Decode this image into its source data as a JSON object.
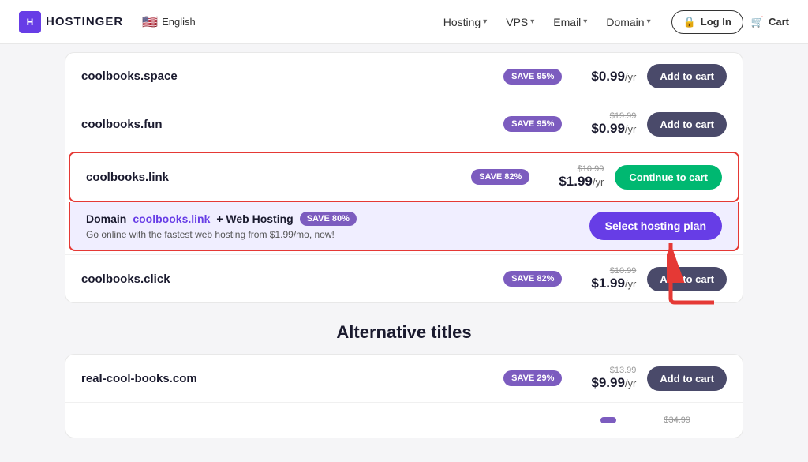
{
  "navbar": {
    "logo_text": "HOSTINGER",
    "lang": "English",
    "nav_items": [
      {
        "label": "Hosting",
        "has_dropdown": true
      },
      {
        "label": "VPS",
        "has_dropdown": true
      },
      {
        "label": "Email",
        "has_dropdown": true
      },
      {
        "label": "Domain",
        "has_dropdown": true
      }
    ],
    "login_label": "Log In",
    "cart_label": "Cart"
  },
  "main": {
    "domains": [
      {
        "name": "coolbooks.space",
        "save_pct": "SAVE 95%",
        "price_original": "",
        "price_current": "$0.99/yr",
        "btn_label": "Add to cart",
        "highlighted": false
      },
      {
        "name": "coolbooks.fun",
        "save_pct": "SAVE 95%",
        "price_original": "$19.99",
        "price_current": "$0.99/yr",
        "btn_label": "Add to cart",
        "highlighted": false
      },
      {
        "name": "coolbooks.link",
        "save_pct": "SAVE 82%",
        "price_original": "$10.99",
        "price_current": "$1.99/yr",
        "btn_label": "Continue to cart",
        "highlighted": true,
        "btn_type": "continue"
      }
    ],
    "bundle": {
      "prefix": "Domain ",
      "link_text": "coolbooks.link",
      "suffix": " + Web Hosting",
      "save_badge": "SAVE 80%",
      "desc": "Go online with the fastest web hosting from $1.99/mo, now!",
      "btn_label": "Select hosting plan"
    },
    "domains_bottom": [
      {
        "name": "coolbooks.click",
        "save_pct": "SAVE 82%",
        "price_original": "$10.99",
        "price_current": "$1.99/yr",
        "btn_label": "Add to cart"
      }
    ],
    "section_title": "Alternative titles",
    "alt_domains": [
      {
        "name": "real-cool-books.com",
        "save_pct": "SAVE 29%",
        "price_original": "$13.99",
        "price_current": "$9.99/yr",
        "btn_label": "Add to cart"
      },
      {
        "name": "",
        "save_pct": "",
        "price_original": "$34.99",
        "price_current": "",
        "btn_label": ""
      }
    ]
  }
}
